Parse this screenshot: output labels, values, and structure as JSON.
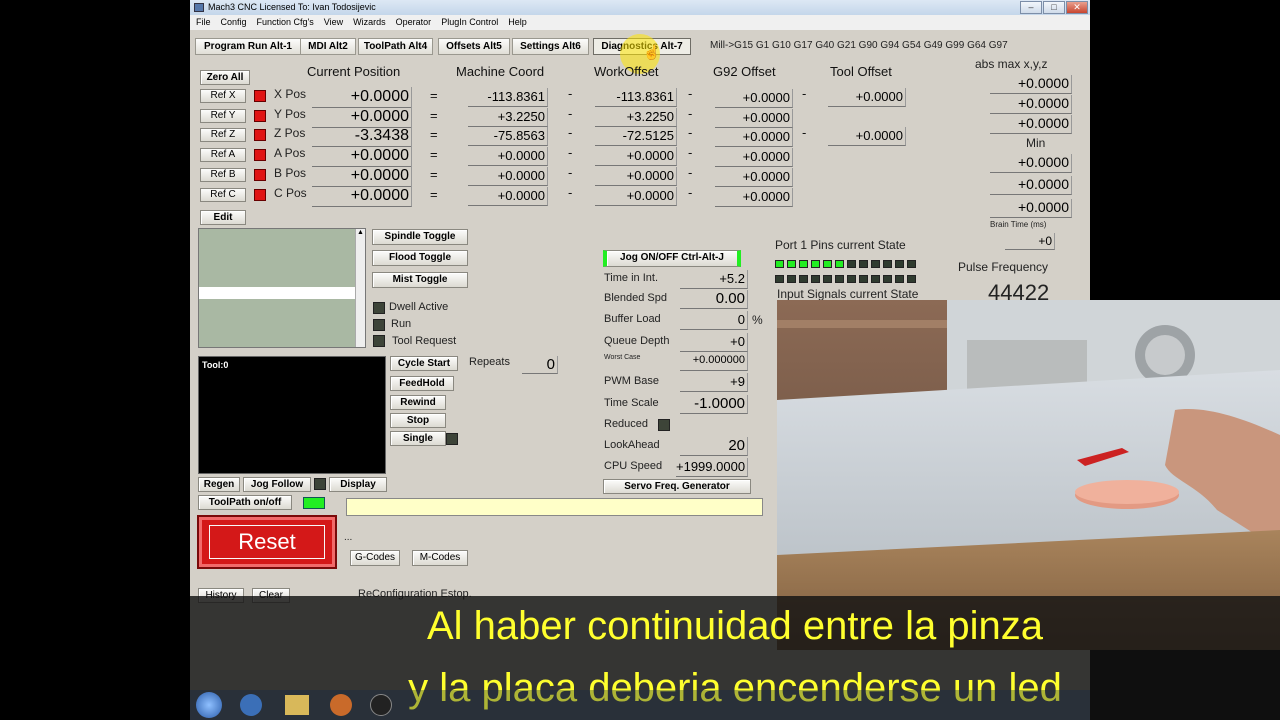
{
  "window": {
    "title": "Mach3 CNC  Licensed To: Ivan Todosijevic",
    "controls": [
      "–",
      "□",
      "✕"
    ]
  },
  "menu": [
    "File",
    "Config",
    "Function Cfg's",
    "View",
    "Wizards",
    "Operator",
    "PlugIn Control",
    "Help"
  ],
  "tabs": [
    "Program Run Alt-1",
    "MDI Alt2",
    "ToolPath Alt4",
    "Offsets Alt5",
    "Settings Alt6",
    "Diagnostics Alt-7"
  ],
  "gcode_state": "Mill->G15  G1 G10 G17 G40 G21 G90 G94 G54 G49 G99 G64 G97",
  "headers": {
    "current_position": "Current Position",
    "machine_coord": "Machine Coord",
    "work_offset": "WorkOffset",
    "g92_offset": "G92 Offset",
    "tool_offset": "Tool Offset",
    "abs_max": "abs max x,y,z",
    "min": "Min",
    "brain_time": "Brain Time (ms)"
  },
  "zero_all": "Zero All",
  "edit": "Edit",
  "axes": [
    {
      "ref": "Ref X",
      "name": "X Pos",
      "pos": "+0.0000",
      "machine": "-113.8361",
      "work": "-113.8361",
      "g92": "+0.0000",
      "tool": "+0.0000"
    },
    {
      "ref": "Ref Y",
      "name": "Y Pos",
      "pos": "+0.0000",
      "machine": "+3.2250",
      "work": "+3.2250",
      "g92": "+0.0000",
      "tool": ""
    },
    {
      "ref": "Ref Z",
      "name": "Z Pos",
      "pos": "-3.3438",
      "machine": "-75.8563",
      "work": "-72.5125",
      "g92": "+0.0000",
      "tool": "+0.0000"
    },
    {
      "ref": "Ref A",
      "name": "A Pos",
      "pos": "+0.0000",
      "machine": "+0.0000",
      "work": "+0.0000",
      "g92": "+0.0000",
      "tool": ""
    },
    {
      "ref": "Ref B",
      "name": "B Pos",
      "pos": "+0.0000",
      "machine": "+0.0000",
      "work": "+0.0000",
      "g92": "+0.0000",
      "tool": ""
    },
    {
      "ref": "Ref C",
      "name": "C Pos",
      "pos": "+0.0000",
      "machine": "+0.0000",
      "work": "+0.0000",
      "g92": "+0.0000",
      "tool": ""
    }
  ],
  "abs_max_values": [
    "+0.0000",
    "+0.0000",
    "+0.0000"
  ],
  "min_values": [
    "+0.0000",
    "+0.0000",
    "+0.0000"
  ],
  "brain_time_value": "+0",
  "toggles": [
    "Spindle Toggle",
    "Flood Toggle",
    "Mist Toggle"
  ],
  "status_leds": [
    "Dwell Active",
    "Run",
    "Tool Request"
  ],
  "tool_label": "Tool:0",
  "cycle_buttons": [
    "Cycle Start",
    "FeedHold",
    "Rewind",
    "Stop",
    "Single"
  ],
  "repeats_label": "Repeats",
  "repeats_value": "0",
  "jog_button": "Jog ON/OFF Ctrl-Alt-J",
  "diag": [
    {
      "label": "Time in Int.",
      "value": "+5.2"
    },
    {
      "label": "Blended Spd",
      "value": "0.00"
    },
    {
      "label": "Buffer Load",
      "value": "0",
      "unit": "%"
    },
    {
      "label": "Queue Depth",
      "value": "+0"
    },
    {
      "label": "Worst Case",
      "value": "+0.000000"
    },
    {
      "label": "PWM Base",
      "value": "+9"
    },
    {
      "label": "Time Scale",
      "value": "-1.0000"
    },
    {
      "label": "Reduced",
      "value": ""
    },
    {
      "label": "LookAhead",
      "value": "20"
    },
    {
      "label": "CPU Speed",
      "value": "+1999.0000"
    }
  ],
  "servo_button": "Servo Freq. Generator",
  "port_pins_label": "Port 1 Pins current State",
  "pulse_freq_label": "Pulse Frequency",
  "pulse_freq_value": "44422",
  "input_signals_label": "Input Signals current State",
  "bottom_buttons": {
    "regen": "Regen",
    "jog_follow": "Jog Follow",
    "display": "Display",
    "toolpath": "ToolPath on/off"
  },
  "reset": "Reset",
  "ellipsis": "...",
  "gcodes": "G-Codes",
  "mcodes": "M-Codes",
  "history": "History",
  "clear": "Clear",
  "status_message": "ReConfiguration Estop.",
  "subtitles": [
    "Al haber continuidad entre la pinza",
    "y la placa deberia encenderse un led"
  ],
  "colors": {
    "led_red": "#e01414",
    "led_green": "#22ee22",
    "subtitle": "#ffff2e"
  }
}
